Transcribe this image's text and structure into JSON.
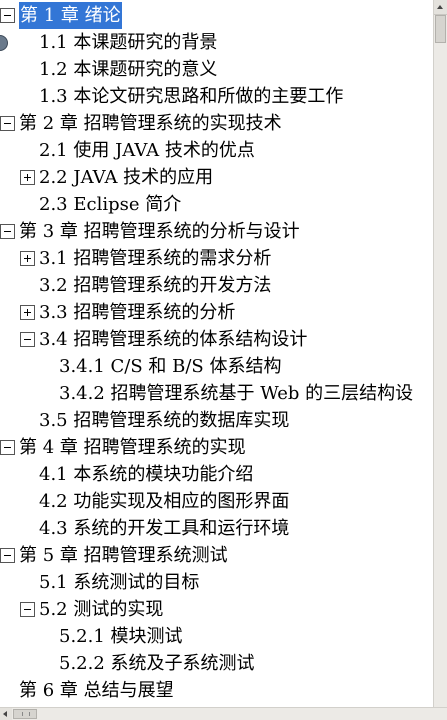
{
  "tree": {
    "items": [
      {
        "label": "第 1 章  绪论",
        "level": 0,
        "toggle": "minus",
        "selected": true
      },
      {
        "label": "1.1  本课题研究的背景",
        "level": 1,
        "toggle": "none"
      },
      {
        "label": "1.2  本课题研究的意义",
        "level": 1,
        "toggle": "none"
      },
      {
        "label": "1.3  本论文研究思路和所做的主要工作",
        "level": 1,
        "toggle": "none"
      },
      {
        "label": "第 2 章  招聘管理系统的实现技术",
        "level": 0,
        "toggle": "minus"
      },
      {
        "label": "2.1  使用 JAVA 技术的优点",
        "level": 1,
        "toggle": "none"
      },
      {
        "label": "2.2 JAVA 技术的应用",
        "level": 1,
        "toggle": "plus"
      },
      {
        "label": "2.3 Eclipse 简介",
        "level": 1,
        "toggle": "none"
      },
      {
        "label": "第 3 章  招聘管理系统的分析与设计",
        "level": 0,
        "toggle": "minus"
      },
      {
        "label": "3.1  招聘管理系统的需求分析",
        "level": 1,
        "toggle": "plus"
      },
      {
        "label": "3.2  招聘管理系统的开发方法",
        "level": 1,
        "toggle": "none"
      },
      {
        "label": "3.3  招聘管理系统的分析",
        "level": 1,
        "toggle": "plus"
      },
      {
        "label": "3.4  招聘管理系统的体系结构设计",
        "level": 1,
        "toggle": "minus"
      },
      {
        "label": "3.4.1 C/S 和 B/S 体系结构",
        "level": 2,
        "toggle": "none"
      },
      {
        "label": "3.4.2 招聘管理系统基于 Web 的三层结构设",
        "level": 2,
        "toggle": "none"
      },
      {
        "label": "3.5  招聘管理系统的数据库实现",
        "level": 1,
        "toggle": "none"
      },
      {
        "label": "第 4 章  招聘管理系统的实现",
        "level": 0,
        "toggle": "minus"
      },
      {
        "label": "4.1 本系统的模块功能介绍",
        "level": 1,
        "toggle": "none"
      },
      {
        "label": "4.2 功能实现及相应的图形界面",
        "level": 1,
        "toggle": "none"
      },
      {
        "label": "4.3  系统的开发工具和运行环境",
        "level": 1,
        "toggle": "none"
      },
      {
        "label": "第 5 章  招聘管理系统测试",
        "level": 0,
        "toggle": "minus"
      },
      {
        "label": "5.1 系统测试的目标",
        "level": 1,
        "toggle": "none"
      },
      {
        "label": "5.2 测试的实现",
        "level": 1,
        "toggle": "minus"
      },
      {
        "label": "5.2.1 模块测试",
        "level": 2,
        "toggle": "none"
      },
      {
        "label": "5.2.2 系统及子系统测试",
        "level": 2,
        "toggle": "none"
      },
      {
        "label": "第 6 章  总结与展望",
        "level": 0,
        "toggle": "none"
      }
    ]
  },
  "colors": {
    "selection_bg": "#3376d6",
    "selection_text": "#ffffff",
    "text": "#000000"
  }
}
